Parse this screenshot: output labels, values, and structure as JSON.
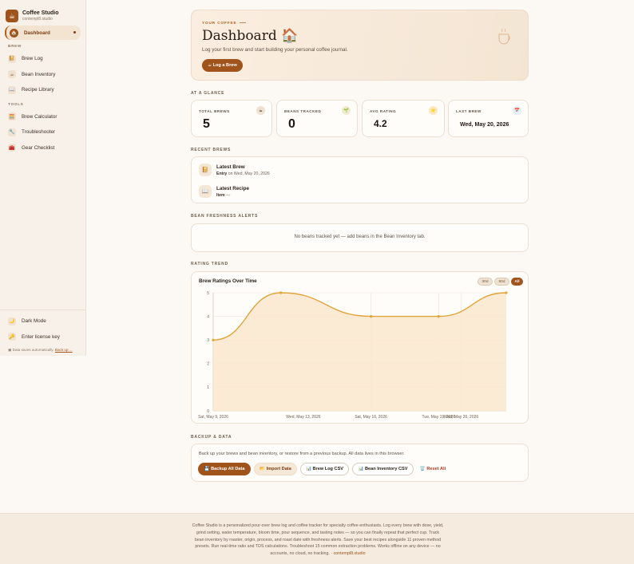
{
  "app": {
    "name": "Coffee Studio",
    "domain": "contempl8.studio",
    "logo_glyph": "☕"
  },
  "sidebar": {
    "active": {
      "label": "Dashboard",
      "glyph": "🏠"
    },
    "sections": [
      {
        "title": "BREW",
        "items": [
          {
            "label": "Brew Log",
            "glyph": "📔"
          },
          {
            "label": "Bean Inventory",
            "glyph": "☕"
          },
          {
            "label": "Recipe Library",
            "glyph": "📖"
          }
        ]
      },
      {
        "title": "TOOLS",
        "items": [
          {
            "label": "Brew Calculator",
            "glyph": "🧮"
          },
          {
            "label": "Troubleshooter",
            "glyph": "🔧"
          },
          {
            "label": "Gear Checklist",
            "glyph": "🧰"
          }
        ]
      }
    ],
    "bottom": [
      {
        "label": "Dark Mode",
        "glyph": "🌙"
      },
      {
        "label": "Enter license key",
        "glyph": "🔑"
      }
    ],
    "saved_text": "Data saves automatically.",
    "saved_link": "Back up ..."
  },
  "hero": {
    "kicker": "YOUR COFFEE",
    "title": "Dashboard 🏠",
    "subtitle": "Log your first brew and start building your personal coffee journal.",
    "button": "☕ Log a Brew"
  },
  "glance": {
    "label": "AT A GLANCE",
    "stats": [
      {
        "label": "TOTAL BREWS",
        "value": "5",
        "glyph": "☕",
        "color": "#eee2d2"
      },
      {
        "label": "BEANS TRACKED",
        "value": "0",
        "glyph": "🌱",
        "color": "#f1ead0"
      },
      {
        "label": "AVG RATING",
        "value": "4.2",
        "glyph": "⭐",
        "color": "#fbe9c2"
      },
      {
        "label": "LAST BREW",
        "value": "Wed, May 20, 2026",
        "glyph": "📅",
        "color": "#e6edf3"
      }
    ]
  },
  "recent": {
    "label": "RECENT BREWS",
    "items": [
      {
        "title": "Latest Brew",
        "bold": "Entry",
        "rest": " on Wed, May 20, 2026",
        "glyph": "📔"
      },
      {
        "title": "Latest Recipe",
        "bold": "Item",
        "rest": " —",
        "glyph": "📖"
      }
    ]
  },
  "freshness": {
    "label": "BEAN FRESHNESS ALERTS",
    "empty": "No beans tracked yet — add beans in the Bean Inventory tab."
  },
  "trend": {
    "label": "RATING TREND",
    "chart_title": "Brew Ratings Over Time",
    "chips": [
      "30d",
      "90d",
      "All"
    ],
    "active_chip": "All"
  },
  "chart_data": {
    "type": "area",
    "title": "Brew Ratings Over Time",
    "x": [
      "2026-05-09",
      "2026-05-13",
      "2026-05-16",
      "2026-05-19",
      "2026-05-20"
    ],
    "x_tick_labels": [
      "Sat, May 9, 2026",
      "Wed, May 13, 2026",
      "Sat, May 16, 2026",
      "Tue, May 19, 2026",
      "Wed, May 20, 2026"
    ],
    "points": [
      {
        "date": "2026-05-09",
        "value": 3
      },
      {
        "date": "2026-05-12",
        "value": 5
      },
      {
        "date": "2026-05-16",
        "value": 4
      },
      {
        "date": "2026-05-19",
        "value": 4
      },
      {
        "date": "2026-05-22",
        "value": 5
      }
    ],
    "ylim": [
      0,
      5
    ],
    "y_ticks": [
      0,
      1,
      2,
      3,
      4,
      5
    ],
    "line_color": "#dfa43a",
    "fill_color": "#fbe8cc",
    "grid": true
  },
  "backup": {
    "label": "BACKUP & DATA",
    "desc": "Back up your brews and bean inventory, or restore from a previous backup. All data lives in this browser.",
    "buttons": [
      {
        "label": "💾 Backup All Data",
        "style": "primary"
      },
      {
        "label": "📂 Import Data",
        "style": "soft"
      },
      {
        "label": "📊 Brew Log CSV",
        "style": "outline"
      },
      {
        "label": "📊 Bean Inventory CSV",
        "style": "outline"
      },
      {
        "label": "🗑️ Reset All",
        "style": "danger"
      }
    ]
  },
  "footer": {
    "text": "Coffee Studio is a personalized pour-over brew log and coffee tracker for specialty coffee enthusiasts. Log every brew with dose, yield, grind setting, water temperature, bloom time, pour sequence, and tasting notes — so you can finally repeat that perfect cup. Track bean inventory by roaster, origin, process, and roast date with freshness alerts. Save your best recipes alongside 11 proven method presets. Run real-time ratio and TDS calculations. Troubleshoot 15 common extraction problems. Works offline on any device — no accounts, no cloud, no tracking. · ",
    "link": "contempl8.studio"
  }
}
